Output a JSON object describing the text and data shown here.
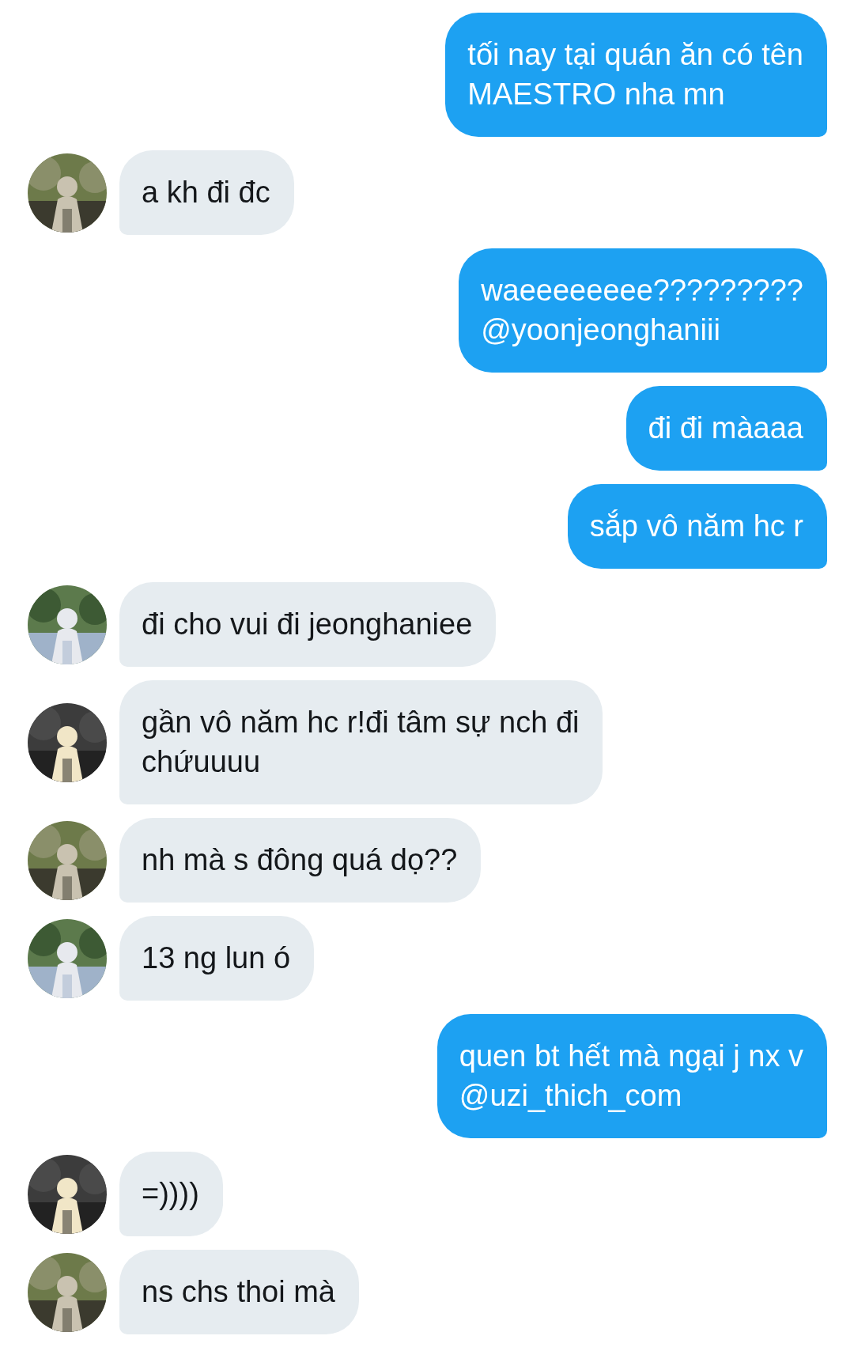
{
  "messages": [
    {
      "kind": "outgoing",
      "text": "tối nay tại quán ăn có tên\nMAESTRO nha mn"
    },
    {
      "kind": "incoming",
      "text": "a kh đi đc"
    },
    {
      "kind": "outgoing",
      "text": "waeeeeeeee?????????\n@yoonjeonghaniii"
    },
    {
      "kind": "outgoing",
      "text": "đi đi màaaa"
    },
    {
      "kind": "outgoing",
      "text": "sắp vô năm hc r"
    },
    {
      "kind": "incoming",
      "text": "đi cho vui đi jeonghaniee"
    },
    {
      "kind": "incoming",
      "text": "gần vô năm hc r!đi tâm sự nch đi\nchứuuuu"
    },
    {
      "kind": "incoming",
      "text": "nh mà s đông quá dọ??"
    },
    {
      "kind": "incoming",
      "text": "13 ng lun ó"
    },
    {
      "kind": "outgoing",
      "text": "quen bt hết mà ngại j nx v\n@uzi_thich_com"
    },
    {
      "kind": "incoming",
      "text": "=))))"
    },
    {
      "kind": "incoming",
      "text": "ns chs thoi mà"
    }
  ]
}
